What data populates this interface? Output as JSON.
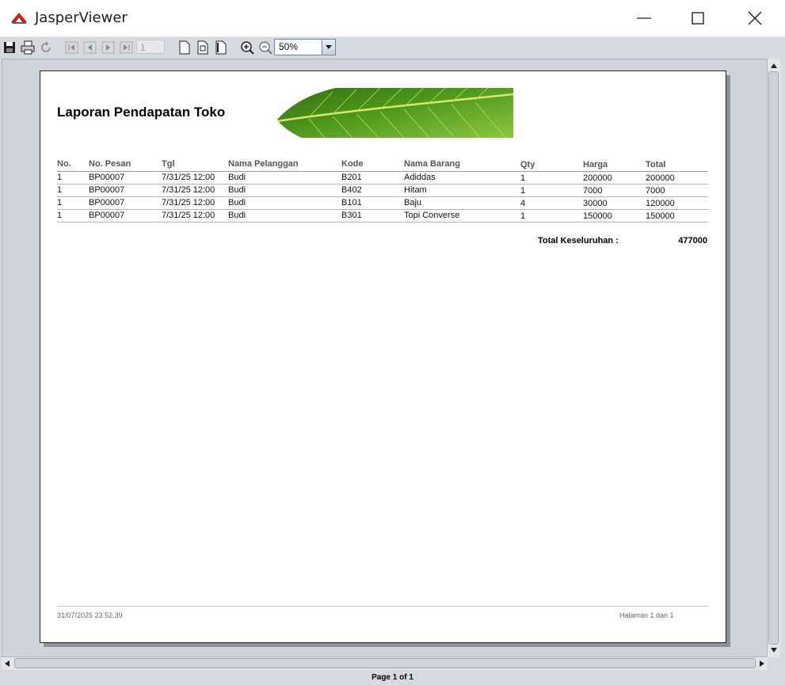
{
  "window": {
    "title": "JasperViewer"
  },
  "toolbar": {
    "page_number": "1",
    "zoom": "50%"
  },
  "report": {
    "title": "Laporan Pendapatan Toko",
    "columns": [
      "No.",
      "No. Pesan",
      "Tgl",
      "Nama Pelanggan",
      "Kode",
      "Nama Barang",
      "Qty",
      "Harga",
      "Total"
    ],
    "rows": [
      [
        "1",
        "BP00007",
        "7/31/25 12:00",
        "Budi",
        "B201",
        "Adiddas",
        "1",
        "200000",
        "200000"
      ],
      [
        "1",
        "BP00007",
        "7/31/25 12:00",
        "Budi",
        "B402",
        "Hitam",
        "1",
        "7000",
        "7000"
      ],
      [
        "1",
        "BP00007",
        "7/31/25 12:00",
        "Budi",
        "B101",
        "Baju",
        "4",
        "30000",
        "120000"
      ],
      [
        "1",
        "BP00007",
        "7/31/25 12:00",
        "Budi",
        "B301",
        "Topi Converse",
        "1",
        "150000",
        "150000"
      ]
    ],
    "total_label": "Total Keseluruhan :",
    "total_value": "477000",
    "footer_date": "31/07/2025 23.52.39",
    "footer_page": "Halaman 1 dari 1"
  },
  "status": {
    "page_indicator": "Page 1 of 1"
  },
  "colors": {
    "app_icon_red": "#c0231f",
    "leaf_green": "#5aa61e"
  }
}
